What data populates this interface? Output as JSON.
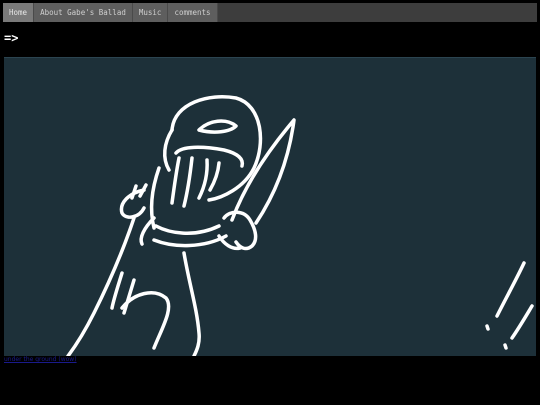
{
  "nav": {
    "items": [
      {
        "label": "Home"
      },
      {
        "label": "About Gabe's Ballad"
      },
      {
        "label": "Music"
      },
      {
        "label": "comments"
      }
    ]
  },
  "page": {
    "next_arrow": "=>"
  },
  "footer": {
    "link_text": "under the ground (wow)"
  },
  "colors": {
    "panel_bg": "#1d3039",
    "page_bg": "#000000",
    "nav_bg": "#3d3d3d",
    "drawing_stroke": "#ffffff"
  }
}
